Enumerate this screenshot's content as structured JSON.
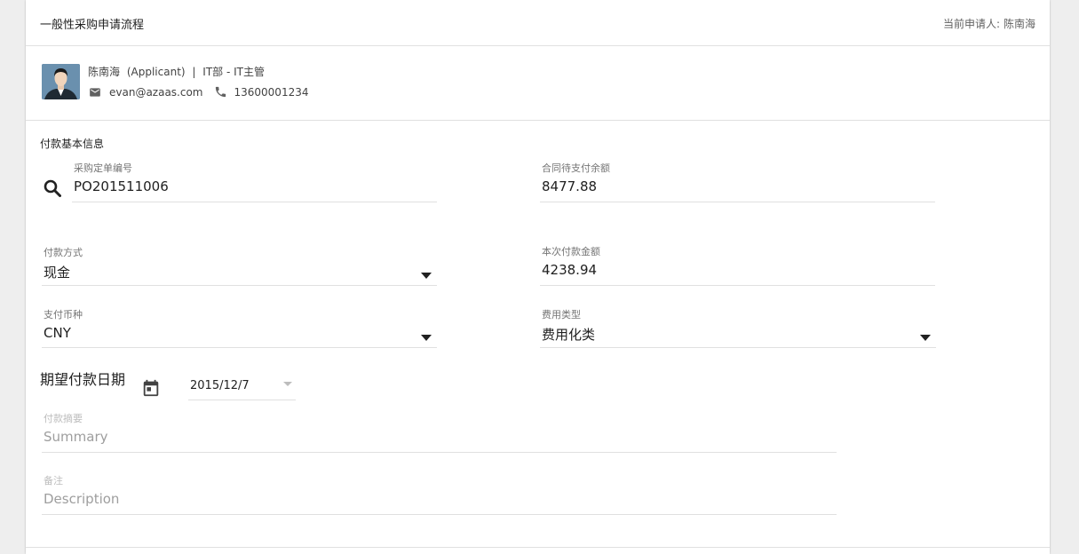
{
  "header": {
    "title": "一般性采购申请流程",
    "current_applicant_label": "当前申请人:",
    "current_applicant_name": "陈南海"
  },
  "applicant": {
    "name": "陈南海",
    "role": "(Applicant)",
    "separator": "|",
    "dept": "IT部 - IT主管",
    "email": "evan@azaas.com",
    "phone": "13600001234",
    "icons": {
      "email": "email-icon",
      "phone": "phone-icon",
      "avatar": "avatar-icon"
    }
  },
  "payment": {
    "section_title": "付款基本信息",
    "po_number": {
      "label": "采购定单编号",
      "value": "PO201511006",
      "icon": "search-icon"
    },
    "contract_balance": {
      "label": "合同待支付余额",
      "value": "8477.88"
    },
    "payment_method": {
      "label": "付款方式",
      "value": "现金"
    },
    "payment_amount": {
      "label": "本次付款金额",
      "value": "4238.94"
    },
    "currency": {
      "label": "支付币种",
      "value": "CNY"
    },
    "expense_type": {
      "label": "费用类型",
      "value": "费用化类"
    },
    "expected_date": {
      "label": "期望付款日期",
      "value": "2015/12/7",
      "icon": "calendar-icon"
    },
    "summary": {
      "label": "付款摘要",
      "placeholder": "Summary"
    },
    "remarks": {
      "label": "备注",
      "placeholder": "Description"
    }
  },
  "colors": {
    "background": "#eeeeee",
    "card": "#ffffff",
    "divider": "#e0e0e0",
    "avatar_bg": "#5f88a8"
  }
}
